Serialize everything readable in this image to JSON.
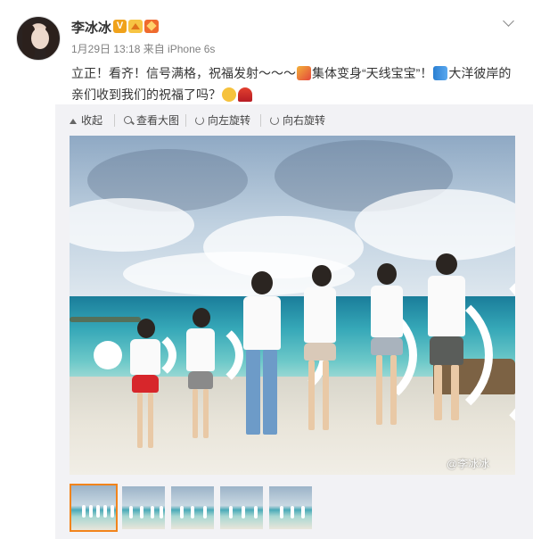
{
  "user": {
    "name": "李冰冰"
  },
  "post": {
    "meta": "1月29日 13:18 来自 iPhone 6s",
    "text_part1": "立正！看齐！信号满格，祝福发射～～～",
    "text_part2": "集体变身“天线宝宝”！",
    "text_part3": "大洋彼岸的亲们收到我们的祝福了吗？",
    "emojis": [
      "party-popper-icon",
      "signal-bars-icon",
      "grinning-face-icon",
      "dancer-icon"
    ]
  },
  "toolbar": {
    "collapse": "收起",
    "view_large": "查看大图",
    "rotate_left": "向左旋转",
    "rotate_right": "向右旋转"
  },
  "photo": {
    "watermark": "@李冰冰"
  },
  "thumbnails": {
    "count": 5,
    "selected_index": 0
  },
  "colors": {
    "accent_orange": "#f2841c",
    "text_gray": "#808080",
    "panel_bg": "#f2f2f5"
  }
}
